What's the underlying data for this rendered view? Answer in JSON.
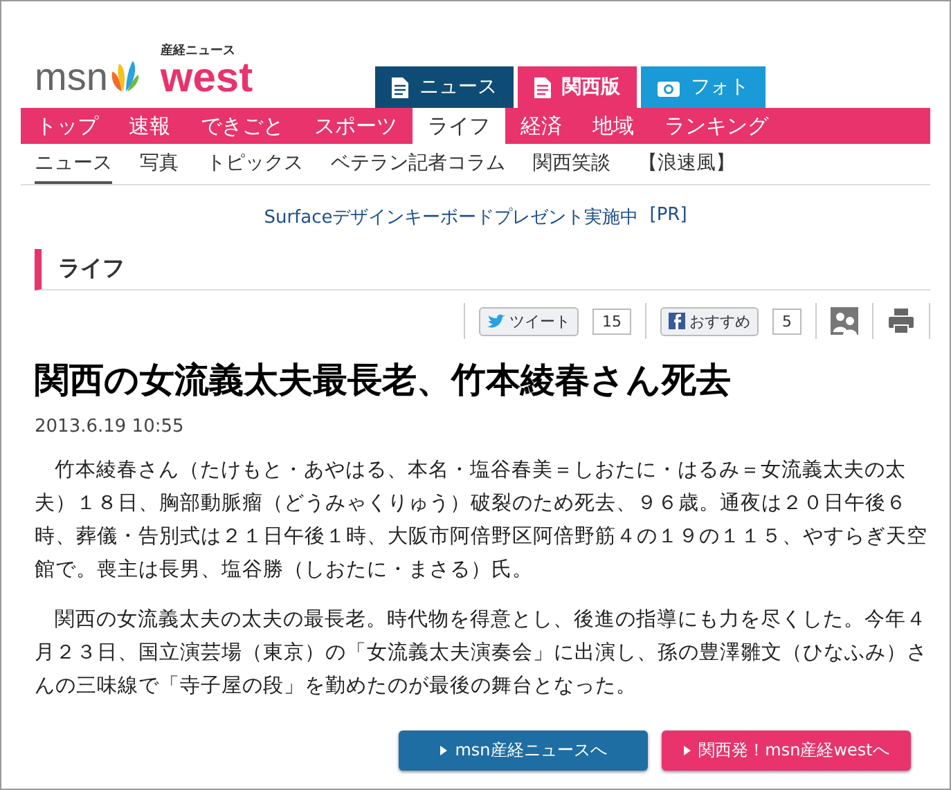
{
  "logo": {
    "msn": "msn",
    "sub": "産経ニュース",
    "west": "west"
  },
  "site_tabs": [
    {
      "label": "ニュース",
      "kind": "doc",
      "color": "#0f4c75",
      "selected": false
    },
    {
      "label": "関西版",
      "kind": "doc",
      "color": "#e8336c",
      "selected": true
    },
    {
      "label": "フォト",
      "kind": "camera",
      "color": "#1a9ad6",
      "selected": false
    }
  ],
  "nav": [
    {
      "label": "トップ",
      "selected": false
    },
    {
      "label": "速報",
      "selected": false
    },
    {
      "label": "できごと",
      "selected": false
    },
    {
      "label": "スポーツ",
      "selected": false
    },
    {
      "label": "ライフ",
      "selected": true
    },
    {
      "label": "経済",
      "selected": false
    },
    {
      "label": "地域",
      "selected": false
    },
    {
      "label": "ランキング",
      "selected": false
    }
  ],
  "subnav": [
    {
      "label": "ニュース",
      "selected": true
    },
    {
      "label": "写真",
      "selected": false
    },
    {
      "label": "トピックス",
      "selected": false
    },
    {
      "label": "ベテラン記者コラム",
      "selected": false
    },
    {
      "label": "関西笑談",
      "selected": false
    },
    {
      "label": "【浪速風】",
      "selected": false
    }
  ],
  "pr": {
    "link": "Surfaceデザインキーボードプレゼント実施中",
    "tag": "[PR]"
  },
  "section": "ライフ",
  "share": {
    "tweet": "ツイート",
    "tweet_count": "15",
    "like": "おすすめ",
    "like_count": "5"
  },
  "article": {
    "title": "関西の女流義太夫最長老、竹本綾春さん死去",
    "date": "2013.6.19 10:55",
    "paragraphs": [
      "竹本綾春さん（たけもと・あやはる、本名・塩谷春美＝しおたに・はるみ＝女流義太夫の太夫）１８日、胸部動脈瘤（どうみゃくりゅう）破裂のため死去、９６歳。通夜は２０日午後６時、葬儀・告別式は２１日午後１時、大阪市阿倍野区阿倍野筋４の１９の１１５、やすらぎ天空館で。喪主は長男、塩谷勝（しおたに・まさる）氏。",
      "関西の女流義太夫の太夫の最長老。時代物を得意とし、後進の指導にも力を尽くした。今年４月２３日、国立演芸場（東京）の「女流義太夫演奏会」に出演し、孫の豊澤雛文（ひなふみ）さんの三味線で「寺子屋の段」を勤めたのが最後の舞台となった。"
    ]
  },
  "footer_links": [
    {
      "label": "msn産経ニュースへ",
      "color": "#1f6ea3"
    },
    {
      "label": "関西発！msn産経westへ",
      "color": "#e8336c"
    }
  ]
}
